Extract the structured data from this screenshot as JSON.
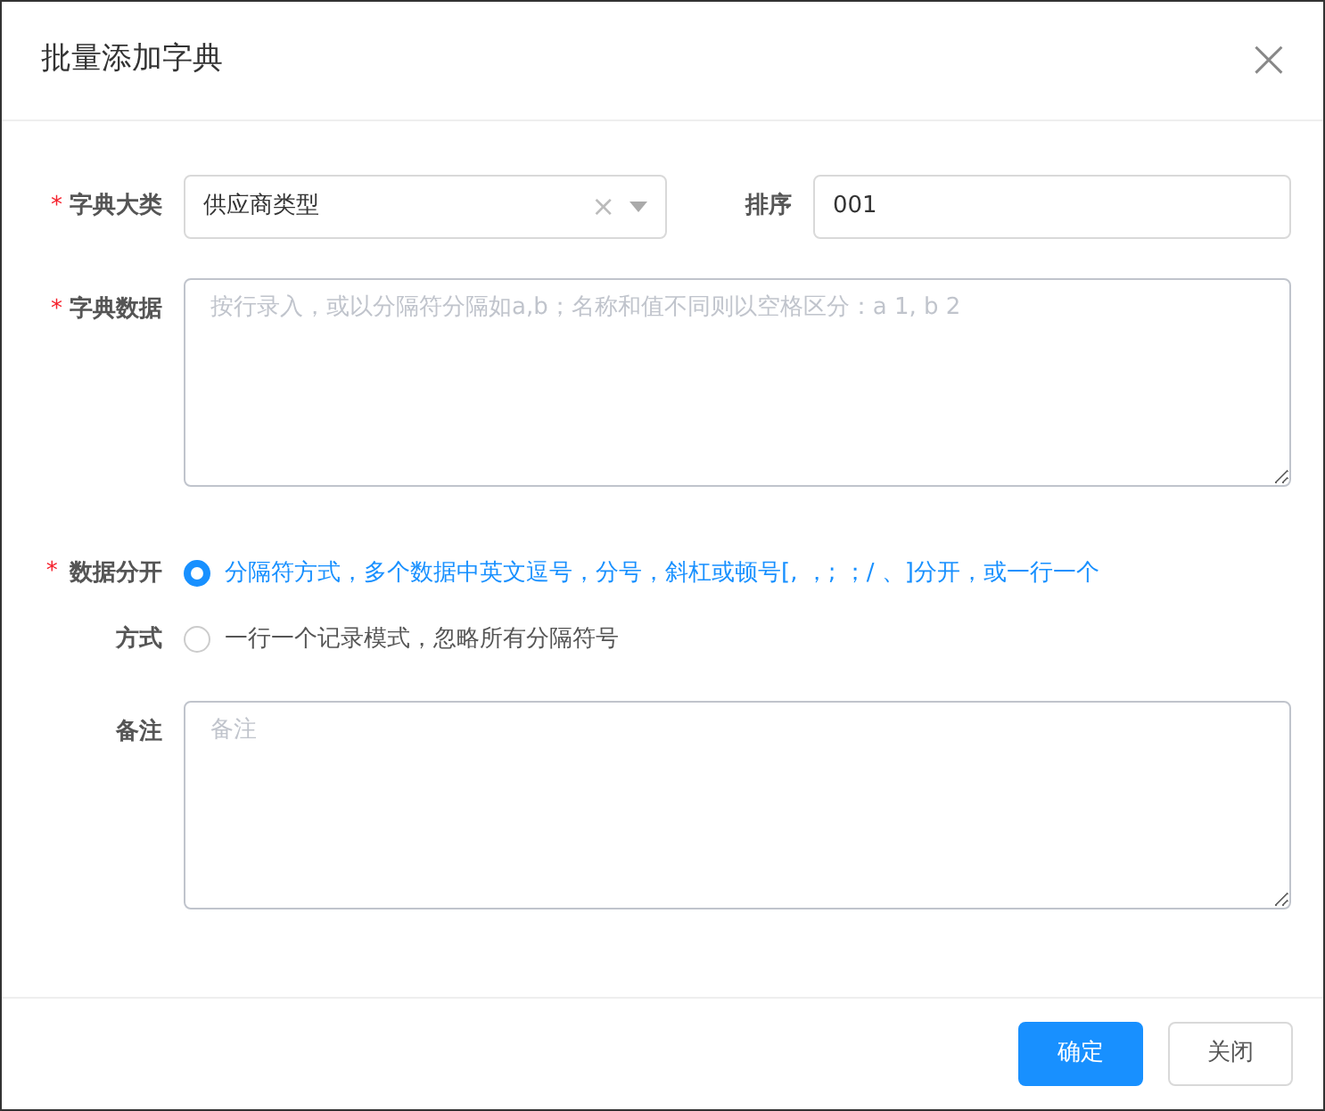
{
  "dialog": {
    "title": "批量添加字典",
    "close": "×"
  },
  "fields": [
    {
      "kind": "select",
      "label": "字典大类",
      "required_mark": "*",
      "value": "供应商类型",
      "clear": "×"
    },
    {
      "kind": "input",
      "label": "排序",
      "value": "001"
    },
    {
      "kind": "textarea",
      "label": "字典数据",
      "required_mark": "*",
      "placeholder": "按行录入，或以分隔符分隔如a,b；名称和值不同则以空格区分：a 1, b 2"
    },
    {
      "kind": "radio",
      "label": "数据分开方式",
      "required_mark": "*",
      "options": [
        {
          "label": "分隔符方式，多个数据中英文逗号，分号，斜杠或顿号[, ，; ；/ 、]分开，或一行一个",
          "selected": true
        },
        {
          "label": "一行一个记录模式，忽略所有分隔符号",
          "selected": false
        }
      ]
    },
    {
      "kind": "textarea",
      "label": "备注",
      "placeholder": "备注"
    }
  ],
  "buttons": [
    {
      "label": "确定",
      "primary": true
    },
    {
      "label": "关闭",
      "primary": false
    }
  ]
}
